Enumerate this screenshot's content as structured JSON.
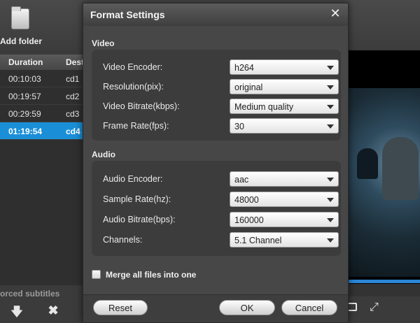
{
  "app": {
    "add_folder_label": "Add folder",
    "forced_subtitles_label": "orced subtitles",
    "file_list": {
      "columns": [
        "Duration",
        "Dest"
      ],
      "rows": [
        {
          "duration": "00:10:03",
          "dest": "cd1"
        },
        {
          "duration": "00:19:57",
          "dest": "cd2"
        },
        {
          "duration": "00:29:59",
          "dest": "cd3"
        },
        {
          "duration": "01:19:54",
          "dest": "cd4"
        }
      ],
      "selected_row": 3
    }
  },
  "dialog": {
    "title": "Format Settings",
    "video": {
      "label": "Video",
      "fields": [
        {
          "label": "Video Encoder:",
          "value": "h264"
        },
        {
          "label": "Resolution(pix):",
          "value": "original"
        },
        {
          "label": "Video Bitrate(kbps):",
          "value": "Medium quality"
        },
        {
          "label": "Frame Rate(fps):",
          "value": "30"
        }
      ]
    },
    "audio": {
      "label": "Audio",
      "fields": [
        {
          "label": "Audio Encoder:",
          "value": "aac"
        },
        {
          "label": "Sample Rate(hz):",
          "value": "48000"
        },
        {
          "label": "Audio Bitrate(bps):",
          "value": "160000"
        },
        {
          "label": "Channels:",
          "value": "5.1 Channel"
        }
      ]
    },
    "merge_label": "Merge all files into one",
    "merge_checked": false,
    "buttons": {
      "reset": "Reset",
      "ok": "OK",
      "cancel": "Cancel"
    }
  },
  "colors": {
    "selection": "#1a8fd8",
    "progress": "#2b86d6"
  },
  "icons": [
    "folder-icon",
    "close-icon",
    "arrow-down-icon",
    "delete-icon",
    "snapshot-icon",
    "fullscreen-icon",
    "dropdown-arrow-icon"
  ]
}
